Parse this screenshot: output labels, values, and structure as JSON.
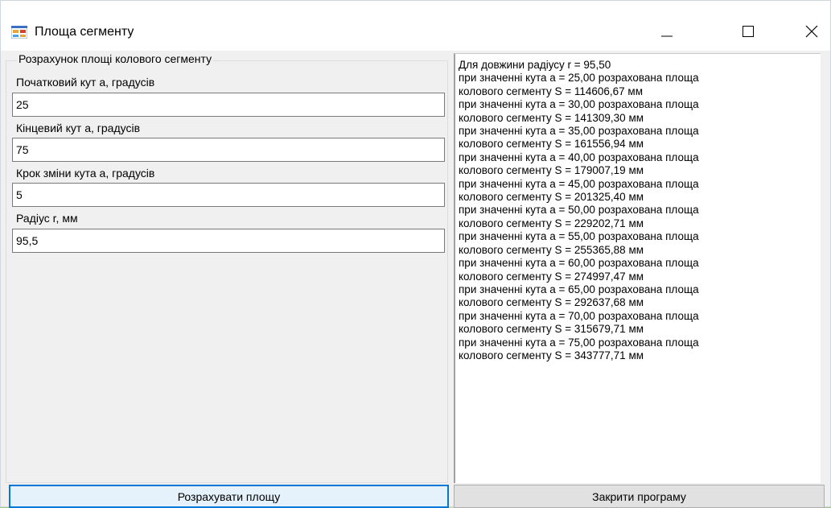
{
  "window": {
    "title": "Площа сегменту"
  },
  "groupbox": {
    "title": "Розрахунок площі колового сегменту"
  },
  "fields": {
    "start_angle": {
      "label": "Початковий кут а,  градусів",
      "value": "25"
    },
    "end_angle": {
      "label": "Кінцевий кут а, градусів",
      "value": "75"
    },
    "step_angle": {
      "label": "Крок зміни кута а,  градусів",
      "value": "5"
    },
    "radius": {
      "label": "Радіус r, мм",
      "value": "95,5"
    }
  },
  "output": {
    "lines": [
      "Для довжини радіусу r = 95,50",
      "при значенні кута а = 25,00 розрахована площа",
      "колового сегменту S = 114606,67 мм",
      "при значенні кута а = 30,00 розрахована площа",
      "колового сегменту S = 141309,30 мм",
      "при значенні кута а = 35,00 розрахована площа",
      "колового сегменту S = 161556,94 мм",
      "при значенні кута а = 40,00 розрахована площа",
      "колового сегменту S = 179007,19 мм",
      "при значенні кута а = 45,00 розрахована площа",
      "колового сегменту S = 201325,40 мм",
      "при значенні кута а = 50,00 розрахована площа",
      "колового сегменту S = 229202,71 мм",
      "при значенні кута а = 55,00 розрахована площа",
      "колового сегменту S = 255365,88 мм",
      "при значенні кута а = 60,00 розрахована площа",
      "колового сегменту S = 274997,47 мм",
      "при значенні кута а = 65,00 розрахована площа",
      "колового сегменту S = 292637,68 мм",
      "при значенні кута а = 70,00 розрахована площа",
      "колового сегменту S = 315679,71 мм",
      "при значенні кута а = 75,00 розрахована площа",
      "колового сегменту S = 343777,71 мм"
    ]
  },
  "buttons": {
    "calculate": "Розрахувати площу",
    "close": "Закрити програму"
  },
  "icons": {
    "app": "app-icon",
    "minimize": "minimize-icon",
    "maximize": "maximize-icon",
    "close": "close-icon"
  },
  "colors": {
    "accent": "#0078d7",
    "window_bg": "#f0f0f0"
  }
}
